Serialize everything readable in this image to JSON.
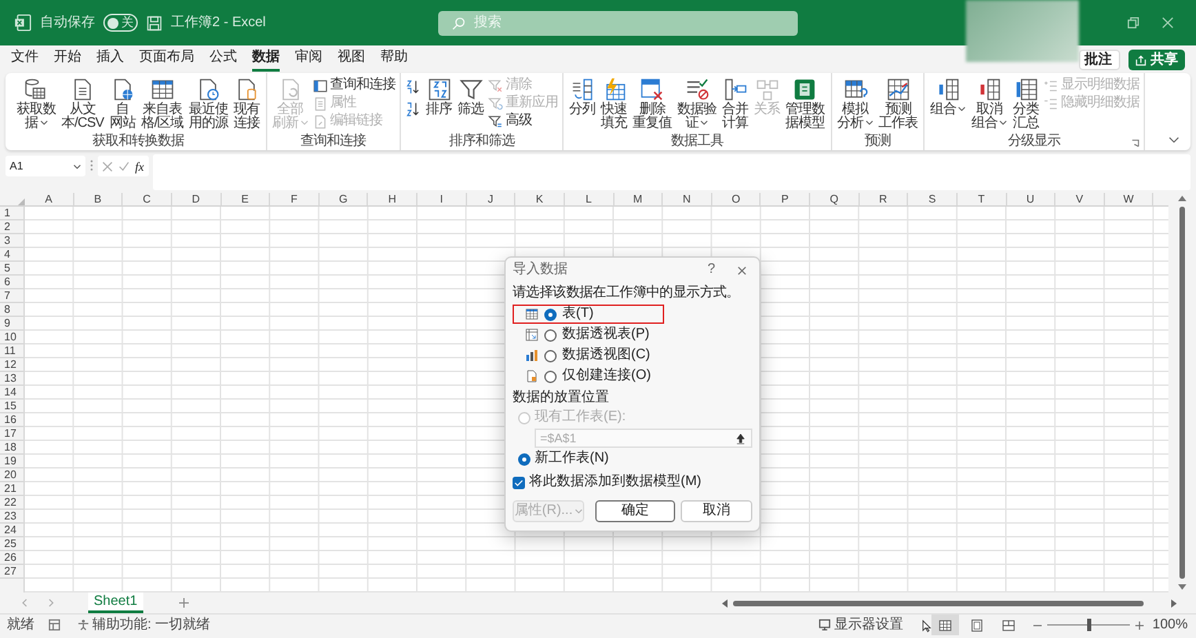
{
  "title_bar": {
    "autosave_label": "自动保存",
    "autosave": {
      "on": false,
      "label": "关"
    },
    "document_title": "工作簿2 - Excel",
    "search": {
      "placeholder": "搜索"
    }
  },
  "menu": {
    "tabs": [
      {
        "label": "文件",
        "selected": false
      },
      {
        "label": "开始",
        "selected": false
      },
      {
        "label": "插入",
        "selected": false
      },
      {
        "label": "页面布局",
        "selected": false
      },
      {
        "label": "公式",
        "selected": false
      },
      {
        "label": "数据",
        "selected": true
      },
      {
        "label": "审阅",
        "selected": false
      },
      {
        "label": "视图",
        "selected": false
      },
      {
        "label": "帮助",
        "selected": false
      }
    ],
    "comments_button": "批注",
    "share_button": "共享"
  },
  "ribbon": {
    "groups": [
      {
        "label": "获取和转换数据",
        "items": [
          {
            "kind": "large",
            "lines": [
              "获取数",
              "据"
            ],
            "dropdown": true,
            "disabled": false
          },
          {
            "kind": "large",
            "lines": [
              "从文",
              "本/CSV"
            ],
            "dropdown": false,
            "disabled": false
          },
          {
            "kind": "large",
            "lines": [
              "自",
              "网站"
            ],
            "dropdown": false,
            "disabled": false
          },
          {
            "kind": "large",
            "lines": [
              "来自表",
              "格/区域"
            ],
            "dropdown": false,
            "disabled": false
          },
          {
            "kind": "large",
            "lines": [
              "最近使",
              "用的源"
            ],
            "dropdown": false,
            "disabled": false
          },
          {
            "kind": "large",
            "lines": [
              "现有",
              "连接"
            ],
            "dropdown": false,
            "disabled": false
          }
        ]
      },
      {
        "label": "查询和连接",
        "items": [
          {
            "kind": "large",
            "lines": [
              "全部",
              "刷新"
            ],
            "dropdown": true,
            "disabled": true
          },
          {
            "kind": "stack",
            "items": [
              {
                "label": "查询和连接",
                "disabled": false
              },
              {
                "label": "属性",
                "disabled": true
              },
              {
                "label": "编辑链接",
                "disabled": true
              }
            ]
          }
        ]
      },
      {
        "label": "排序和筛选",
        "items": [
          {
            "kind": "icon-stack",
            "items": [
              {
                "disabled": false
              },
              {
                "disabled": false
              }
            ]
          },
          {
            "kind": "large",
            "lines": [
              "排序"
            ],
            "dropdown": false,
            "disabled": false
          },
          {
            "kind": "large",
            "lines": [
              "筛选"
            ],
            "dropdown": false,
            "disabled": false
          },
          {
            "kind": "stack",
            "items": [
              {
                "label": "清除",
                "disabled": true
              },
              {
                "label": "重新应用",
                "disabled": true
              },
              {
                "label": "高级",
                "disabled": false
              }
            ]
          }
        ]
      },
      {
        "label": "数据工具",
        "items": [
          {
            "kind": "large",
            "lines": [
              "分列"
            ],
            "dropdown": false,
            "disabled": false
          },
          {
            "kind": "large",
            "lines": [
              "快速",
              "填充"
            ],
            "dropdown": false,
            "disabled": false
          },
          {
            "kind": "large",
            "lines": [
              "删除",
              "重复值"
            ],
            "dropdown": false,
            "disabled": false
          },
          {
            "kind": "large",
            "lines": [
              "数据验",
              "证"
            ],
            "dropdown": true,
            "disabled": false
          },
          {
            "kind": "large",
            "lines": [
              "合并",
              "计算"
            ],
            "dropdown": false,
            "disabled": false
          },
          {
            "kind": "large",
            "lines": [
              "关系"
            ],
            "dropdown": false,
            "disabled": true
          },
          {
            "kind": "large",
            "lines": [
              "管理数",
              "据模型"
            ],
            "dropdown": false,
            "disabled": false
          }
        ]
      },
      {
        "label": "预测",
        "items": [
          {
            "kind": "large",
            "lines": [
              "模拟",
              "分析"
            ],
            "dropdown": true,
            "disabled": false
          },
          {
            "kind": "large",
            "lines": [
              "预测",
              "工作表"
            ],
            "dropdown": false,
            "disabled": false
          }
        ]
      },
      {
        "label": "分级显示",
        "launcher": true,
        "items": [
          {
            "kind": "large",
            "lines": [
              "组合"
            ],
            "dropdown": true,
            "disabled": false
          },
          {
            "kind": "large",
            "lines": [
              "取消",
              "组合"
            ],
            "dropdown": true,
            "disabled": false
          },
          {
            "kind": "large",
            "lines": [
              "分类",
              "汇总"
            ],
            "dropdown": false,
            "disabled": false
          },
          {
            "kind": "stack",
            "items": [
              {
                "label": "显示明细数据",
                "disabled": true
              },
              {
                "label": "隐藏明细数据",
                "disabled": true
              }
            ]
          }
        ]
      }
    ]
  },
  "formula_bar": {
    "name_box": "A1",
    "function_button": "fx"
  },
  "sheet": {
    "columns": [
      "A",
      "B",
      "C",
      "D",
      "E",
      "F",
      "G",
      "H",
      "I",
      "J",
      "K",
      "L",
      "M",
      "N",
      "O",
      "P",
      "Q",
      "R",
      "S",
      "T",
      "U",
      "V",
      "W"
    ],
    "rows": [
      "1",
      "2",
      "3",
      "4",
      "5",
      "6",
      "7",
      "8",
      "9",
      "10",
      "11",
      "12",
      "13",
      "14",
      "15",
      "16",
      "17",
      "18",
      "19",
      "20",
      "21",
      "22",
      "23",
      "24",
      "25",
      "26",
      "27"
    ]
  },
  "sheet_tabs": [
    {
      "label": "Sheet1",
      "selected": true
    }
  ],
  "dialog": {
    "title": "导入数据",
    "help": "?",
    "prompt": "请选择该数据在工作簿中的显示方式。",
    "view_options": [
      {
        "label": "表(T)",
        "selected": true,
        "highlighted": true
      },
      {
        "label": "数据透视表(P)",
        "selected": false,
        "highlighted": false
      },
      {
        "label": "数据透视图(C)",
        "selected": false,
        "highlighted": false
      },
      {
        "label": "仅创建连接(O)",
        "selected": false,
        "highlighted": false
      }
    ],
    "placement_label": "数据的放置位置",
    "placement_options": [
      {
        "label": "现有工作表(E):",
        "selected": false,
        "disabled": true,
        "field": {
          "value": "=$A$1",
          "disabled": true
        }
      },
      {
        "label": "新工作表(N)",
        "selected": true,
        "disabled": false
      }
    ],
    "add_to_model": {
      "label": "将此数据添加到数据模型(M)",
      "checked": true
    },
    "buttons": [
      {
        "label": "属性(R)...",
        "kind": "dropdown",
        "disabled": true
      },
      {
        "label": "确定",
        "kind": "default",
        "disabled": false
      },
      {
        "label": "取消",
        "kind": "plain",
        "disabled": false
      }
    ]
  },
  "status_bar": {
    "ready": "就绪",
    "accessibility": "辅助功能: 一切就绪",
    "display_settings": "显示器设置",
    "views": [
      {
        "selected": true
      },
      {
        "selected": false
      },
      {
        "selected": false
      }
    ],
    "zoom": {
      "level": 0.5,
      "reading": "100%"
    }
  }
}
